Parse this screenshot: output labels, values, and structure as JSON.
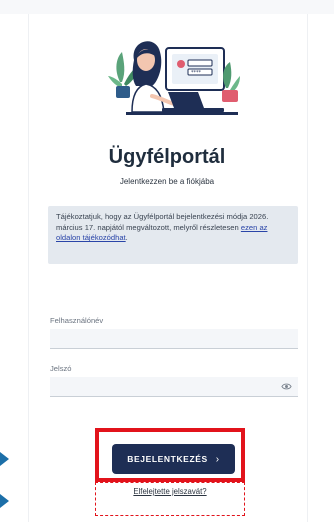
{
  "page": {
    "title": "Ügyfélportál",
    "subtitle": "Jelentkezzen be a fiókjába"
  },
  "notice": {
    "text_before": "Tájékoztatjuk, hogy az Ügyfélportál bejelentkezési módja 2026. március 17. napjától megváltozott, melyről részletesen ",
    "link_text": "ezen az oldalon tájékozódhat",
    "text_after": "."
  },
  "form": {
    "username_label": "Felhasználónév",
    "username_value": "",
    "password_label": "Jelszó",
    "password_value": "",
    "login_button_label": "BEJELENTKEZÉS",
    "login_button_icon": "chevron-right-icon",
    "forgot_link": "Elfelejtette jelszavát?"
  },
  "colors": {
    "primary_button": "#1e2e55",
    "highlight": "#e2131b",
    "arrow": "#1c6fa8",
    "notice_bg": "#e4e9ef"
  }
}
